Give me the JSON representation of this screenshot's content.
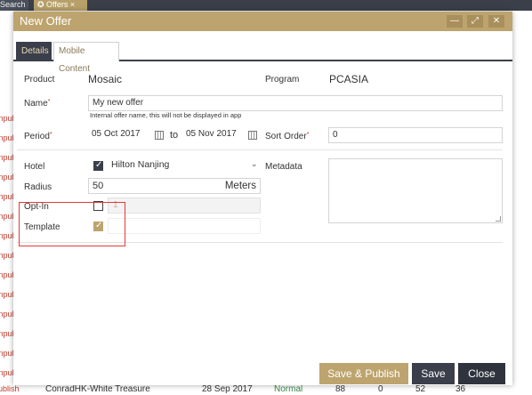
{
  "background": {
    "tabs": [
      {
        "label": "Search ×"
      },
      {
        "label": "✪ Offers ×"
      }
    ],
    "left_status_label": "Unpublish",
    "bottom_row": {
      "status": "Publish",
      "name": "ConradHK-White Treasure",
      "date": "28 Sep 2017",
      "priority": "Normal",
      "c1": "88",
      "c2": "0",
      "c3": "52",
      "c4": "36"
    }
  },
  "modal": {
    "title": "New Offer",
    "window_controls": {
      "minimize": "—",
      "maximize": "⤢",
      "close": "✕"
    },
    "tabs": [
      {
        "label": "Details",
        "active": true
      },
      {
        "label": "Mobile Content",
        "active": false
      }
    ],
    "product": {
      "label": "Product",
      "value": "Mosaic"
    },
    "program": {
      "label": "Program",
      "value": "PCASIA"
    },
    "name": {
      "label": "Name",
      "required_mark": "*",
      "value": "My new offer",
      "hint": "Internal offer name, this will not be displayed in app"
    },
    "period": {
      "label": "Period",
      "required_mark": "*",
      "start": "05 Oct 2017",
      "separator": "to",
      "end": "05 Nov 2017"
    },
    "sort_order": {
      "label": "Sort Order",
      "required_mark": "*",
      "value": "0"
    },
    "hotel": {
      "label": "Hotel",
      "checked": true,
      "value": "Hilton Nanjing"
    },
    "metadata": {
      "label": "Metadata",
      "value": ""
    },
    "radius": {
      "label": "Radius",
      "value": "50",
      "unit": "Meters"
    },
    "opt_in": {
      "label": "Opt-In",
      "checked": false,
      "count": "1"
    },
    "template": {
      "label": "Template",
      "checked": true
    },
    "buttons": {
      "save_publish": "Save & Publish",
      "save": "Save",
      "close": "Close"
    }
  },
  "colors": {
    "accent": "#bda46e",
    "dark": "#3a3f4b",
    "required": "#c0392b",
    "highlight": "#e53935"
  }
}
